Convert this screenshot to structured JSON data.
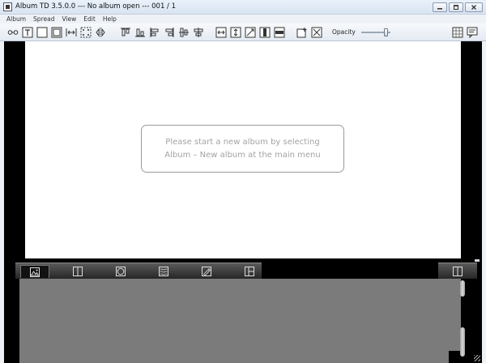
{
  "window": {
    "title": "Album TD 3.5.0.0 --- No album open --- 001 / 1",
    "icon": "app-logo-icon",
    "controls": [
      "minimize-icon",
      "maximize-icon",
      "close-icon"
    ]
  },
  "menu": {
    "items": [
      "Album",
      "Spread",
      "View",
      "Edit",
      "Help"
    ]
  },
  "toolbar": {
    "opacity_label": "Opacity",
    "opacity_value": 0.85,
    "tools": [
      "link-frames-icon",
      "text-frame-icon",
      "photo-frame-icon",
      "frame-border-icon",
      "fit-width-icon",
      "fit-corners-icon",
      "mirror-icon",
      "align-top-icon",
      "align-bottom-icon",
      "align-left-icon",
      "align-right-icon",
      "center-vertical-icon",
      "center-horizontal-icon",
      "stretch-horizontal-icon",
      "stretch-vertical-icon",
      "resize-diagonal-icon",
      "split-vertical-icon",
      "split-horizontal-icon",
      "add-frame-icon",
      "delete-frame-icon",
      "grid-icon",
      "notes-icon"
    ]
  },
  "workspace": {
    "hint_line1": "Please start a new album by selecting",
    "hint_line2": "Album – New album at the main menu"
  },
  "bottom_tabs": {
    "items": [
      "photos-tab-icon",
      "layouts-tab-icon",
      "masks-tab-icon",
      "backgrounds-tab-icon",
      "cliparts-tab-icon",
      "frames-tab-icon"
    ],
    "active": "photos-tab-icon",
    "right_tab": "panel-layout-icon"
  }
}
